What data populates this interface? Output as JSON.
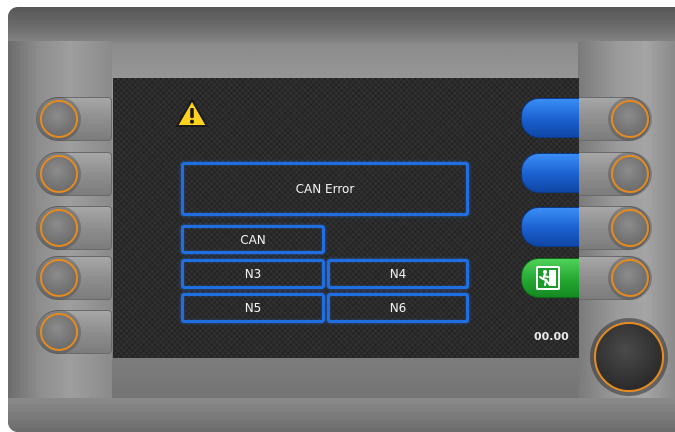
{
  "screen": {
    "error_title": "CAN Error",
    "can_label": "CAN",
    "nodes": [
      "N3",
      "N4",
      "N5",
      "N6"
    ],
    "clock": "00.00"
  },
  "icons": {
    "warning": "warning-triangle-icon",
    "exit": "emergency-exit-icon"
  },
  "colors": {
    "frame_blue": "#1f6fe0",
    "softkey_blue": "#1a5fcf",
    "exit_green": "#24a832",
    "button_ring": "#e58a1e",
    "warning_yellow": "#ffd21f"
  }
}
